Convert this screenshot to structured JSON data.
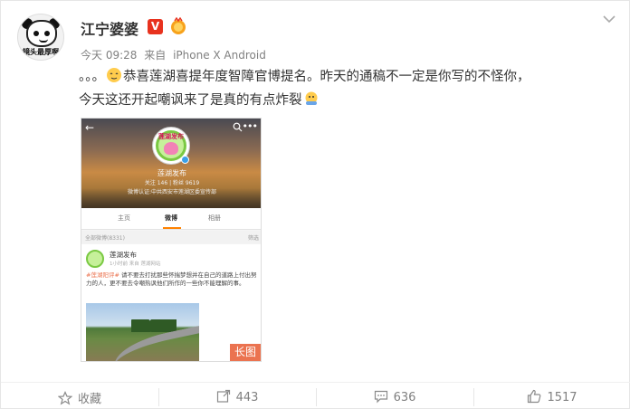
{
  "user": {
    "name": "江宁婆婆",
    "avatar_caption": "镜头最厚啊",
    "verified_badge": "V"
  },
  "meta": {
    "time": "今天 09:28",
    "from_label": "来自",
    "device": "iPhone X Android"
  },
  "post": {
    "dots": "。。。",
    "line1": "恭喜莲湖喜提年度智障官博提名。昨天的通稿不一定是你写的不怪你，",
    "line2": "今天这还开起嘲讽来了是真的有点炸裂"
  },
  "embedded": {
    "account_name": "莲湖发布",
    "logo_text": "莲湖发布",
    "stats": "关注 146 | 粉丝 9619",
    "auth": "微博认证:中共西安市莲湖区委宣传部",
    "tabs": [
      "主页",
      "微博",
      "相册"
    ],
    "active_tab": "微博",
    "bar_left": "全部微博(8331)",
    "bar_right": "筛选",
    "post_name": "莲湖发布",
    "post_time": "1小时前  来自 莲湖网站",
    "post_tag": "#莲湖阳评#",
    "post_text": " 请不要去打扰那些怀揣梦想并在自己的道路上付出努力的人，更不要去令嘲热讽他们所作的一些你不能理解的事。",
    "long_image_tag": "长图"
  },
  "actions": {
    "favorite_label": "收藏",
    "repost_count": "443",
    "comment_count": "636",
    "like_count": "1517"
  },
  "colors": {
    "accent": "#eb7350",
    "badge_red": "#e8321e",
    "meta_gray": "#808080"
  },
  "icons": [
    "more-icon",
    "verified-icon",
    "level-icon",
    "emoji-icon",
    "star-icon",
    "repost-icon",
    "comment-icon",
    "like-icon"
  ]
}
